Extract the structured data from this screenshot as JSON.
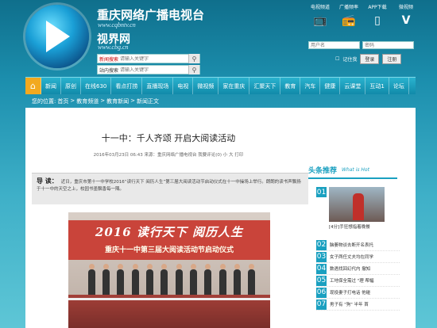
{
  "header": {
    "site_name": "重庆网络广播电视台",
    "site_url": "www.cqbntv.cn",
    "site_name2": "视界网",
    "site_url2": "www.cbg.cn",
    "search1_label": "新闻搜索",
    "search1_placeholder": "请输入关键字",
    "search2_label": "站内搜索",
    "search2_placeholder": "请输入关键字",
    "top_icons": [
      {
        "label": "电视频道",
        "icon": "tv-icon"
      },
      {
        "label": "广播频率",
        "icon": "radio-icon"
      },
      {
        "label": "APP下载",
        "icon": "phone-icon"
      },
      {
        "label": "微视频",
        "icon": "v-icon"
      }
    ],
    "username_placeholder": "用户名",
    "password_placeholder": "密码",
    "remember_label": "记住我",
    "login_button": "登录",
    "register_button": "注册"
  },
  "nav": {
    "items": [
      "新闻",
      "原创",
      "在线630",
      "看点打捞",
      "直播现场",
      "电视",
      "微视频",
      "家在重庆",
      "汇聚天下",
      "教育",
      "汽车",
      "健康",
      "云课堂",
      "互动1",
      "论坛"
    ]
  },
  "breadcrumb": {
    "prefix": "您的位置:",
    "items": [
      "首页",
      "教育频道",
      "教育新闻",
      "新闻正文"
    ],
    "sep": ">"
  },
  "article": {
    "title": "十一中：千人齐颂  开启大阅读活动",
    "meta": "2016年03月23日 06:43 来源：重庆网络广播电视台 我要评论(0) 小 大 打印",
    "summary_label": "导 读：",
    "summary_text": "近日，重庆市第十一中学校2016“读行天下 阅历人生”第三届大阅读活动节启动仪式在十一中操场上举行。朗朗的读书声飘扬于十一中的天空之上，校园书墨飘香每一隅。",
    "photo_banner_1": "2016 读行天下  阅历人生",
    "photo_banner_2": "重庆十一中第三届大阅读活动节启动仪式"
  },
  "sidebar": {
    "title": "头条推荐",
    "title_en": "What is Hot",
    "first_num": "01",
    "first_caption": "[4分]手狂想指着晚餐",
    "items": [
      {
        "num": "02",
        "text": "脑萎物谈去断开名表托"
      },
      {
        "num": "03",
        "text": "女子两任丈夫均在同学"
      },
      {
        "num": "04",
        "text": "数遇找回幻代内 撤知"
      },
      {
        "num": "05",
        "text": "工地保全需过 \"理 帮幅"
      },
      {
        "num": "06",
        "text": "现役妻子打电话 他碰"
      },
      {
        "num": "07",
        "text": "男子有 \"狗\" 半年 首"
      }
    ]
  }
}
